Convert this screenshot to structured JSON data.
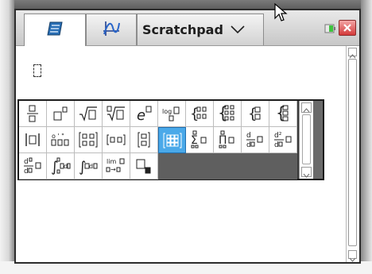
{
  "app": {
    "tabs": [
      {
        "name": "calculator-tab",
        "icon": "calculator-icon",
        "active": true
      },
      {
        "name": "graph-tab",
        "icon": "graph-icon",
        "active": false
      }
    ],
    "document_title": "Scratchpad",
    "title_menu_icon": "chevron-down-icon",
    "status_icon": "battery-icon",
    "close_icon": "close-icon",
    "colors": {
      "selected_template": "#4aa9e9",
      "close_button": "#d43a3a",
      "battery": "#3ec43e"
    }
  },
  "palette": {
    "selected_index": 16,
    "templates": [
      {
        "icon": "fraction-template-icon"
      },
      {
        "icon": "exponent-template-icon"
      },
      {
        "icon": "square-root-template-icon"
      },
      {
        "icon": "nth-root-template-icon"
      },
      {
        "icon": "e-exponent-template-icon"
      },
      {
        "icon": "log-template-icon"
      },
      {
        "icon": "piecewise-2-template-icon"
      },
      {
        "icon": "piecewise-n-template-icon"
      },
      {
        "icon": "system-2-template-icon"
      },
      {
        "icon": "system-n-template-icon"
      },
      {
        "icon": "absolute-value-template-icon"
      },
      {
        "icon": "degree-minute-second-template-icon"
      },
      {
        "icon": "matrix-2x2-template-icon"
      },
      {
        "icon": "matrix-1x2-template-icon"
      },
      {
        "icon": "matrix-2x1-template-icon"
      },
      {
        "icon": "matrix-mxn-template-icon"
      },
      {
        "icon": "sum-template-icon"
      },
      {
        "icon": "product-template-icon"
      },
      {
        "icon": "first-derivative-template-icon"
      },
      {
        "icon": "second-derivative-template-icon"
      },
      {
        "icon": "nth-derivative-template-icon"
      },
      {
        "icon": "definite-integral-template-icon"
      },
      {
        "icon": "indefinite-integral-template-icon"
      },
      {
        "icon": "limit-template-icon"
      },
      {
        "icon": "subscript-template-icon"
      }
    ]
  }
}
